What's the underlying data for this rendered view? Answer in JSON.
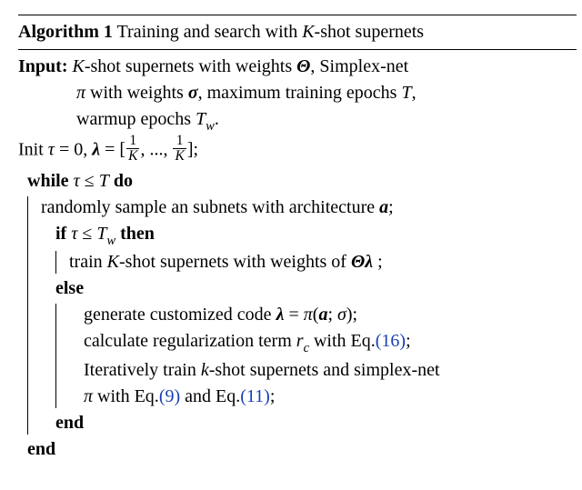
{
  "algo": {
    "number_label": "Algorithm 1",
    "title_rest": " Training and search with ",
    "title_K": "K",
    "title_tail": "-shot supernets"
  },
  "input": {
    "label": "Input:",
    "l1a": " ",
    "l1_K": "K",
    "l1b": "-shot supernets with weights ",
    "l1_Theta": "Θ",
    "l1c": ", Simplex-net",
    "l2a": "π",
    "l2b": " with weights ",
    "l2_sigma": "σ",
    "l2c": ", maximum training epochs ",
    "l2_T": "T",
    "l2d": ",",
    "l3a": "warmup epochs ",
    "l3_Tw_T": "T",
    "l3_Tw_w": "w",
    "l3b": "."
  },
  "init": {
    "a": "Init ",
    "tau": "τ",
    "b": " = 0, ",
    "lambda": "λ",
    "eq": " = [",
    "frac_num": "1",
    "frac_den": "K",
    "mid": ", ..., ",
    "close": "];"
  },
  "while": {
    "kw": "while ",
    "cond_tau": "τ",
    "cond_mid": " ≤ ",
    "cond_T": "T",
    "do": " do"
  },
  "step_sample": {
    "a": "randomly sample an subnets with architecture ",
    "avar": "a",
    "b": ";"
  },
  "if": {
    "kw": "if ",
    "tau": "τ",
    "mid": " ≤ ",
    "Tw_T": "T",
    "Tw_w": "w",
    "then": " then"
  },
  "step_train1": {
    "a": "train ",
    "K": "K",
    "b": "-shot supernets with weights of ",
    "Theta": "Θ",
    "lambda": "λ",
    "tail": " ;"
  },
  "else": {
    "kw": "else"
  },
  "step_gen": {
    "a": "generate customized code ",
    "lambda": "λ",
    "eq": " = ",
    "pi": "π",
    "lp": "(",
    "avar": "a",
    "semi": "; ",
    "sigma": "σ",
    "rp": ");"
  },
  "step_reg": {
    "a": "calculate regularization term ",
    "rc_r": "r",
    "rc_c": "c",
    "b": " with Eq.",
    "ref": "(16)",
    "tail": ";"
  },
  "step_iter1": {
    "a": "Iteratively train ",
    "k": "k",
    "b": "-shot supernets and simplex-net"
  },
  "step_iter2": {
    "pi": "π",
    "a": " with Eq.",
    "ref1": "(9)",
    "mid": " and Eq.",
    "ref2": "(11)",
    "tail": ";"
  },
  "end": {
    "kw": "end"
  }
}
